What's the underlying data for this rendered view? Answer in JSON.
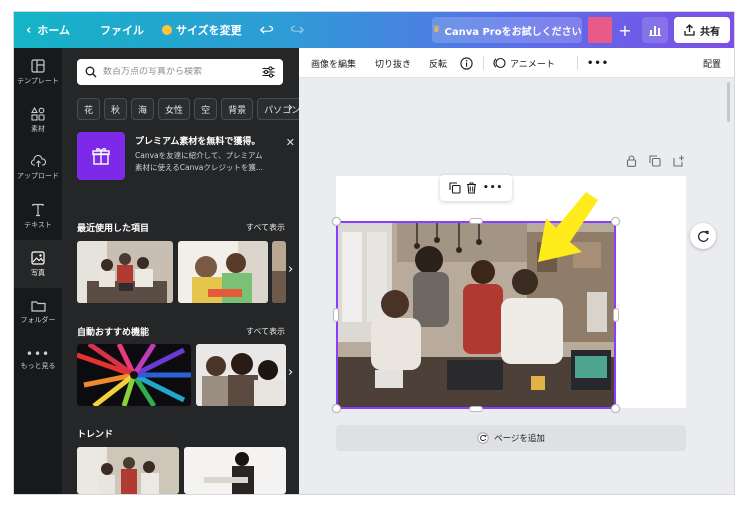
{
  "topbar": {
    "home_label": "ホーム",
    "file_label": "ファイル",
    "resize_label": "サイズを変更",
    "pro_label": "Canva Proをお試しください",
    "share_label": "共有"
  },
  "rail": {
    "items": [
      {
        "label": "テンプレート",
        "icon": "template-icon"
      },
      {
        "label": "素材",
        "icon": "elements-icon"
      },
      {
        "label": "アップロード",
        "icon": "upload-icon"
      },
      {
        "label": "テキスト",
        "icon": "text-icon"
      },
      {
        "label": "写真",
        "icon": "photo-icon"
      },
      {
        "label": "フォルダー",
        "icon": "folder-icon"
      },
      {
        "label": "もっと見る",
        "icon": "more-icon"
      }
    ]
  },
  "panel": {
    "search_placeholder": "数百万点の写真から検索",
    "chips": [
      "花",
      "秋",
      "海",
      "女性",
      "空",
      "背景",
      "パソコン"
    ],
    "promo": {
      "title": "プレミアム素材を無料で獲得。",
      "desc_line1": "Canvaを友達に紹介して、プレミアム",
      "desc_line2": "素材に使えるCanvaクレジットを獲..."
    },
    "sections": [
      {
        "title": "最近使用した項目",
        "see_all": "すべて表示"
      },
      {
        "title": "自動おすすめ機能",
        "see_all": "すべて表示"
      },
      {
        "title": "トレンド"
      }
    ]
  },
  "toolbar": {
    "edit_image": "画像を編集",
    "crop": "切り抜き",
    "flip": "反転",
    "animate": "アニメート",
    "position": "配置"
  },
  "canvas": {
    "add_page": "ページを追加"
  },
  "colors": {
    "accent": "#8b3dff",
    "arrow": "#ffeb1a",
    "panel_bg": "#252627",
    "rail_bg": "#18191b"
  }
}
